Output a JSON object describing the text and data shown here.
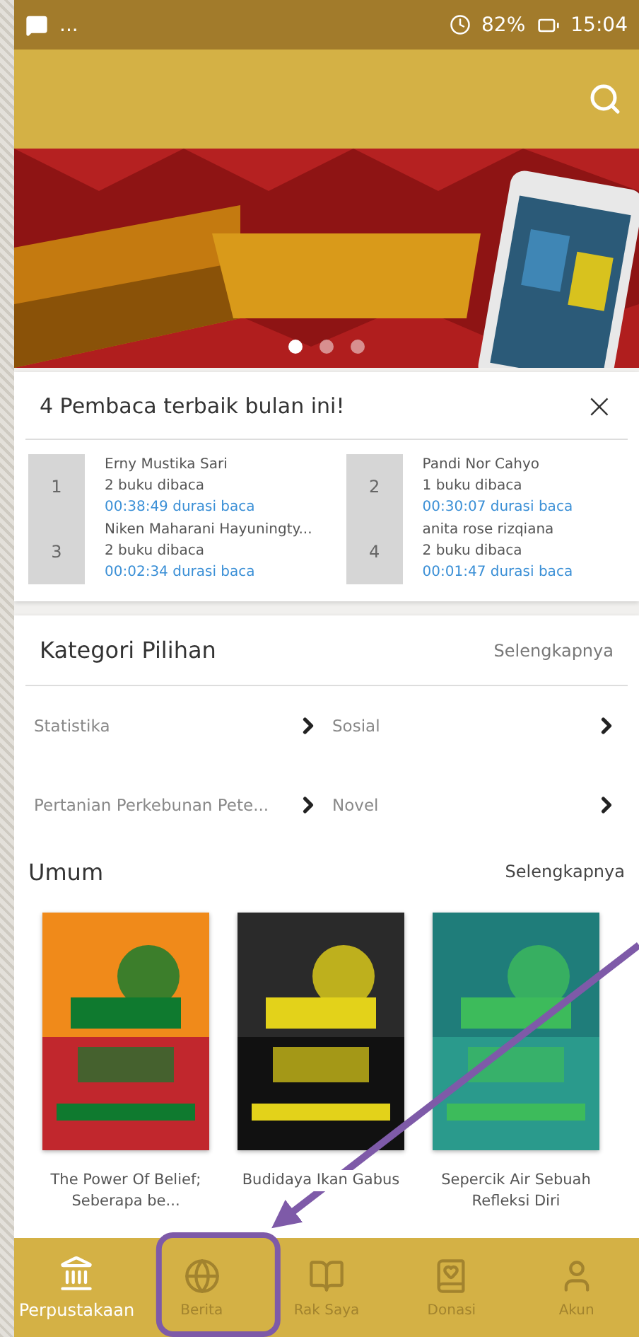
{
  "status_bar": {
    "overflow": "...",
    "battery": "82%",
    "time": "15:04"
  },
  "banner": {
    "dots": [
      {
        "selected": true
      },
      {
        "selected": false
      },
      {
        "selected": false
      }
    ]
  },
  "top_readers": {
    "title": "4 Pembaca terbaik bulan ini!",
    "close": "×",
    "readers": [
      {
        "rank": "1",
        "name": "Erny Mustika Sari",
        "books": "2 buku dibaca",
        "duration": "00:38:49 durasi baca"
      },
      {
        "rank": "2",
        "name": "Pandi Nor Cahyo",
        "books": "1 buku dibaca",
        "duration": "00:30:07 durasi baca"
      },
      {
        "rank": "3",
        "name": "Niken Maharani Hayuningty...",
        "books": "2 buku dibaca",
        "duration": "00:02:34 durasi baca"
      },
      {
        "rank": "4",
        "name": "anita rose rizqiana",
        "books": "2 buku dibaca",
        "duration": "00:01:47 durasi baca"
      }
    ]
  },
  "categories": {
    "title": "Kategori Pilihan",
    "more": "Selengkapnya",
    "items": [
      {
        "label": "Statistika"
      },
      {
        "label": "Sosial"
      },
      {
        "label": "Pertanian Perkebunan Pete..."
      },
      {
        "label": "Novel"
      }
    ]
  },
  "general": {
    "title": "Umum",
    "more": "Selengkapnya",
    "books": [
      {
        "title": "The Power Of Belief; Seberapa be..."
      },
      {
        "title": "Budidaya Ikan Gabus"
      },
      {
        "title": "Sepercik Air Sebuah Refleksi Diri"
      }
    ]
  },
  "bottom_nav": [
    {
      "label": "Perpustakaan",
      "selected": true
    },
    {
      "label": "Berita",
      "selected": false
    },
    {
      "label": "Rak Saya",
      "selected": false
    },
    {
      "label": "Donasi",
      "selected": false
    },
    {
      "label": "Akun",
      "selected": false
    }
  ]
}
